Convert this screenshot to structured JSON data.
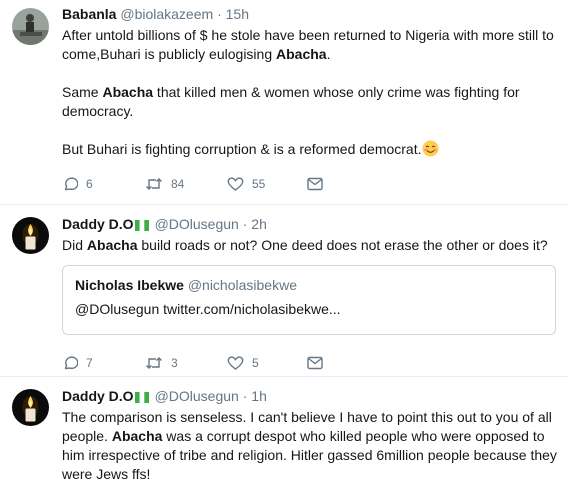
{
  "tweets": [
    {
      "name": "Babanla",
      "handle": "@biolakazeem",
      "separator": "·",
      "time": "15h",
      "lines": {
        "l1a": "After untold billions of $ he stole have been returned to Nigeria with more still to",
        "l1b": "come,Buhari is publicly eulogising ",
        "l1kw": "Abacha",
        "l1c": ".",
        "l2a": "Same ",
        "l2kw": "Abacha",
        "l2b": " that killed men & women whose only crime was fighting for",
        "l2c": "democracy.",
        "l3": "But Buhari is fighting corruption & is a reformed democrat."
      },
      "replies": "6",
      "retweets": "84",
      "likes": "55"
    },
    {
      "name": "Daddy D.O",
      "handle": "@DOlusegun",
      "separator": "·",
      "time": "2h",
      "lines": {
        "a": "Did ",
        "kw": "Abacha",
        "b": " build roads or not? One deed does not erase the other or does it?"
      },
      "quote": {
        "name": "Nicholas Ibekwe",
        "handle": "@nicholasibekwe",
        "text": "@DOlusegun twitter.com/nicholasibekwe..."
      },
      "replies": "7",
      "retweets": "3",
      "likes": "5"
    },
    {
      "name": "Daddy D.O",
      "handle": "@DOlusegun",
      "separator": "·",
      "time": "1h",
      "lines": {
        "l1": "The comparison is senseless. I can't believe I have to point this out to you of all",
        "l2a": "people. ",
        "l2kw": "Abacha",
        "l2b": " was a corrupt despot who killed people who were opposed to",
        "l3": "him irrespective of tribe and religion. Hitler gassed 6million people because they",
        "l4": "were Jews ffs!"
      }
    }
  ],
  "colors": {
    "icon_gray": "#657786",
    "border": "#e6ecf0",
    "nigeria_green": "#3fae49"
  },
  "icons": [
    "reply-icon",
    "retweet-icon",
    "like-icon",
    "message-icon",
    "nigeria-flag-icon",
    "blush-emoji-icon"
  ]
}
